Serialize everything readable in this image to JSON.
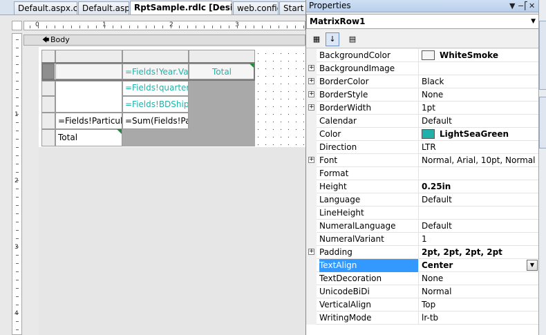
{
  "tabs": [
    {
      "label": "Default.aspx.cs",
      "active": false
    },
    {
      "label": "Default.aspx",
      "active": false
    },
    {
      "label": "RptSample.rdlc [Design]*",
      "active": true
    },
    {
      "label": "web.config",
      "active": false
    },
    {
      "label": "Start",
      "active": false
    }
  ],
  "ruler": {
    "h_labels": [
      "0",
      "1",
      "2",
      "3"
    ],
    "v_labels": [
      "1",
      "2",
      "3",
      "4"
    ]
  },
  "designer": {
    "body_label": "Body",
    "matrix": {
      "year_cell": "=Fields!Year.Va",
      "total_header": "Total",
      "quarter_cell": "=Fields!quarter.",
      "bdship_cell": "=Fields!BDShip",
      "particular_cell": "=Fields!Particul",
      "sum_cell": "=Sum(Fields!Pa",
      "total_row": "Total"
    }
  },
  "properties": {
    "title": "Properties",
    "object": "MatrixRow1",
    "rows": [
      {
        "name": "BackgroundColor",
        "value": "WhiteSmoke",
        "bold": true,
        "swatch": "#f5f5f5",
        "expandable": false
      },
      {
        "name": "BackgroundImage",
        "value": "",
        "bold": false,
        "expandable": true
      },
      {
        "name": "BorderColor",
        "value": "Black",
        "bold": false,
        "expandable": true
      },
      {
        "name": "BorderStyle",
        "value": "None",
        "bold": false,
        "expandable": true
      },
      {
        "name": "BorderWidth",
        "value": "1pt",
        "bold": false,
        "expandable": true
      },
      {
        "name": "Calendar",
        "value": "Default",
        "bold": false,
        "expandable": false
      },
      {
        "name": "Color",
        "value": "LightSeaGreen",
        "bold": true,
        "swatch": "#20b2aa",
        "expandable": false
      },
      {
        "name": "Direction",
        "value": "LTR",
        "bold": false,
        "expandable": false
      },
      {
        "name": "Font",
        "value": "Normal, Arial, 10pt, Normal",
        "bold": false,
        "expandable": true
      },
      {
        "name": "Format",
        "value": "",
        "bold": false,
        "expandable": false
      },
      {
        "name": "Height",
        "value": "0.25in",
        "bold": true,
        "expandable": false
      },
      {
        "name": "Language",
        "value": "Default",
        "bold": false,
        "expandable": false
      },
      {
        "name": "LineHeight",
        "value": "",
        "bold": false,
        "expandable": false
      },
      {
        "name": "NumeralLanguage",
        "value": "Default",
        "bold": false,
        "expandable": false
      },
      {
        "name": "NumeralVariant",
        "value": "1",
        "bold": false,
        "expandable": false
      },
      {
        "name": "Padding",
        "value": "2pt, 2pt, 2pt, 2pt",
        "bold": true,
        "expandable": true
      },
      {
        "name": "TextAlign",
        "value": "Center",
        "bold": true,
        "expandable": false,
        "selected": true
      },
      {
        "name": "TextDecoration",
        "value": "None",
        "bold": false,
        "expandable": false
      },
      {
        "name": "UnicodeBiDi",
        "value": "Normal",
        "bold": false,
        "expandable": false
      },
      {
        "name": "VerticalAlign",
        "value": "Top",
        "bold": false,
        "expandable": false
      },
      {
        "name": "WritingMode",
        "value": "lr-tb",
        "bold": false,
        "expandable": false
      }
    ]
  },
  "icons": {
    "categorized": "categorized-icon",
    "alphabetical": "alphabetical-icon",
    "property_pages": "property-pages-icon"
  }
}
